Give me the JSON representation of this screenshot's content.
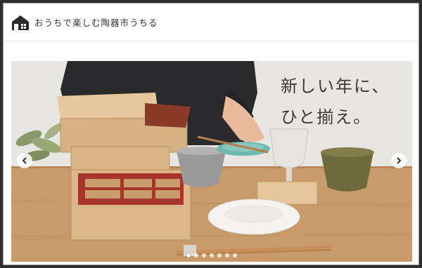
{
  "header": {
    "logo_icon": "house-icon",
    "site_title": "おうちで楽しむ陶器市うちる"
  },
  "slider": {
    "headline_line1": "新しい年に、",
    "headline_line2": "ひと揃え。",
    "prev_icon": "chevron-left-icon",
    "next_icon": "chevron-right-icon",
    "slide_count": 7,
    "active_index": 0
  },
  "colors": {
    "accent_text": "#333333",
    "table_wood": "#c99a6a",
    "box_wood": "#e2c299",
    "box_inner_red": "#a8352c"
  }
}
